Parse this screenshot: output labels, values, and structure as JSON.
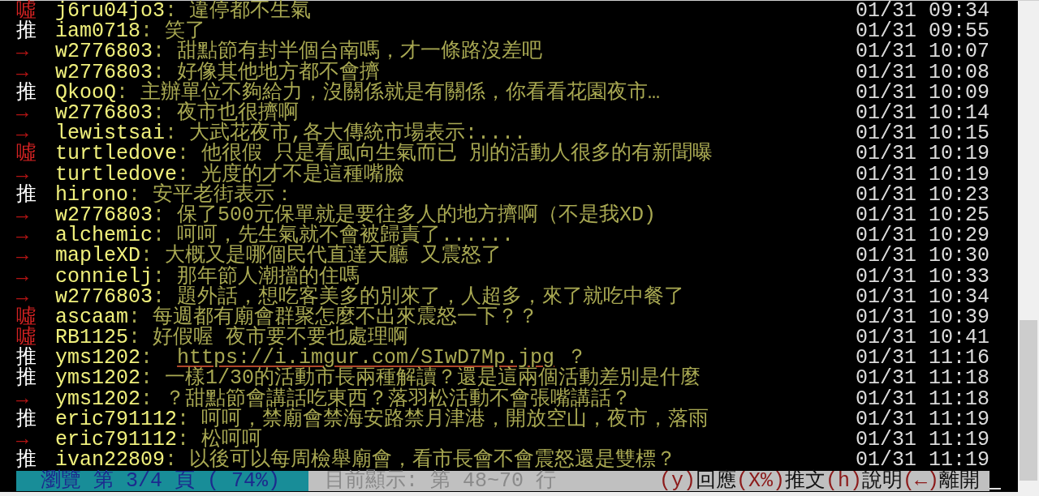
{
  "comments": [
    {
      "kind": "boo",
      "tag": "噓",
      "user": "j6ru04jo3",
      "text": ": 違停都不生氣",
      "time": "01/31 09:34"
    },
    {
      "kind": "push",
      "tag": "推",
      "user": "iam0718",
      "text": ": 笑了",
      "time": "01/31 09:55"
    },
    {
      "kind": "arrow",
      "tag": "→",
      "user": "w2776803",
      "text": ": 甜點節有封半個台南嗎，才一條路沒差吧",
      "time": "01/31 10:07"
    },
    {
      "kind": "arrow",
      "tag": "→",
      "user": "w2776803",
      "text": ": 好像其他地方都不會擠",
      "time": "01/31 10:08"
    },
    {
      "kind": "push",
      "tag": "推",
      "user": "QkooQ",
      "text": ": 主辦單位不夠給力，沒關係就是有關係，你看看花園夜市…",
      "time": "01/31 10:09"
    },
    {
      "kind": "arrow",
      "tag": "→",
      "user": "w2776803",
      "text": ": 夜市也很擠啊",
      "time": "01/31 10:14"
    },
    {
      "kind": "arrow",
      "tag": "→",
      "user": "lewistsai",
      "text": ": 大武花夜市,各大傳統市場表示:....",
      "time": "01/31 10:15"
    },
    {
      "kind": "boo",
      "tag": "噓",
      "user": "turtledove",
      "text": ": 他很假 只是看風向生氣而已 別的活動人很多的有新聞曝",
      "time": "01/31 10:19"
    },
    {
      "kind": "arrow",
      "tag": "→",
      "user": "turtledove",
      "text": ": 光度的才不是這種嘴臉",
      "time": "01/31 10:19"
    },
    {
      "kind": "push",
      "tag": "推",
      "user": "hirono",
      "text": ": 安平老街表示：",
      "time": "01/31 10:23"
    },
    {
      "kind": "arrow",
      "tag": "→",
      "user": "w2776803",
      "text": ": 保了500元保單就是要往多人的地方擠啊（不是我XD)",
      "time": "01/31 10:25"
    },
    {
      "kind": "arrow",
      "tag": "→",
      "user": "alchemic",
      "text": ": 呵呵，先生氣就不會被歸責了......",
      "time": "01/31 10:29"
    },
    {
      "kind": "arrow",
      "tag": "→",
      "user": "mapleXD",
      "text": ": 大概又是哪個民代直達天廳 又震怒了",
      "time": "01/31 10:30"
    },
    {
      "kind": "arrow",
      "tag": "→",
      "user": "connielj",
      "text": ": 那年節人潮擋的住嗎",
      "time": "01/31 10:33"
    },
    {
      "kind": "arrow",
      "tag": "→",
      "user": "w2776803",
      "text": ": 題外話，想吃客美多的別來了，人超多，來了就吃中餐了",
      "time": "01/31 10:34"
    },
    {
      "kind": "boo",
      "tag": "噓",
      "user": "ascaam",
      "text": ": 每週都有廟會群聚怎麼不出來震怒一下？？",
      "time": "01/31 10:39"
    },
    {
      "kind": "boo",
      "tag": "噓",
      "user": "RB1125",
      "text": ": 好假喔 夜市要不要也處理啊",
      "time": "01/31 10:41"
    },
    {
      "kind": "push",
      "tag": "推",
      "user": "yms1202",
      "text": ":  ",
      "link": "https://i.imgur.com/SIwD7Mp.jpg",
      "after": " ？",
      "time": "01/31 11:16"
    },
    {
      "kind": "push",
      "tag": "推",
      "user": "yms1202",
      "text": ": 一樣1/30的活動市長兩種解讀？還是這兩個活動差別是什麼",
      "time": "01/31 11:18"
    },
    {
      "kind": "arrow",
      "tag": "→",
      "user": "yms1202",
      "text": ": ？甜點節會講話吃東西？落羽松活動不會張嘴講話？",
      "time": "01/31 11:18"
    },
    {
      "kind": "push",
      "tag": "推",
      "user": "eric791112",
      "text": ": 呵呵，禁廟會禁海安路禁月津港，開放空山，夜市，落雨",
      "time": "01/31 11:19"
    },
    {
      "kind": "arrow",
      "tag": "→",
      "user": "eric791112",
      "text": ": 松呵呵",
      "time": "01/31 11:19"
    },
    {
      "kind": "push",
      "tag": "推",
      "user": "ivan22809",
      "text": ": 以後可以每周檢舉廟會，看市長會不會震怒還是雙標？",
      "time": "01/31 11:19"
    }
  ],
  "status_bar": {
    "page_info": "瀏覽 第 3/4 頁 ( 74%)",
    "position": "目前顯示: 第 48~70 行",
    "keys": [
      {
        "key": "(y)",
        "label": "回應"
      },
      {
        "key": "(X%)",
        "label": "推文"
      },
      {
        "key": "(h)",
        "label": "說明"
      },
      {
        "key": "(←)",
        "label": "離開"
      }
    ]
  }
}
